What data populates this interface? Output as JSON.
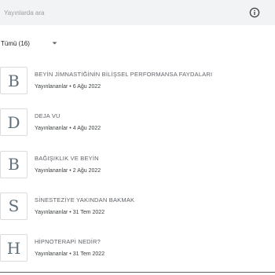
{
  "search": {
    "placeholder": "Yayınlarda ara"
  },
  "filter": {
    "label": "Tümü (16)"
  },
  "status_label": "Yayınlananlar",
  "separator": "•",
  "posts": [
    {
      "letter": "B",
      "title": "BEYİN JİMNASTİĞİNİN BİLİŞSEL PERFORMANSA FAYDALARI",
      "date": "6 Ağu 2022"
    },
    {
      "letter": "D",
      "title": "DEJA VU",
      "date": "4 Ağu 2022"
    },
    {
      "letter": "B",
      "title": "BAĞIŞIKLIK VE BEYİN",
      "date": "2 Ağu 2022"
    },
    {
      "letter": "S",
      "title": "SİNESTEZİYE YAKINDAN BAKMAK",
      "date": "31 Tem 2022"
    },
    {
      "letter": "H",
      "title": "HİPNOTERAPİ NEDİR?",
      "date": "31 Tem 2022"
    }
  ],
  "icons": {
    "info": "info-icon",
    "filter_toggle": "chevron-down-icon"
  },
  "colors": {
    "topbar": "#f1f3f4",
    "avatar_text": "#5f6f7a"
  }
}
